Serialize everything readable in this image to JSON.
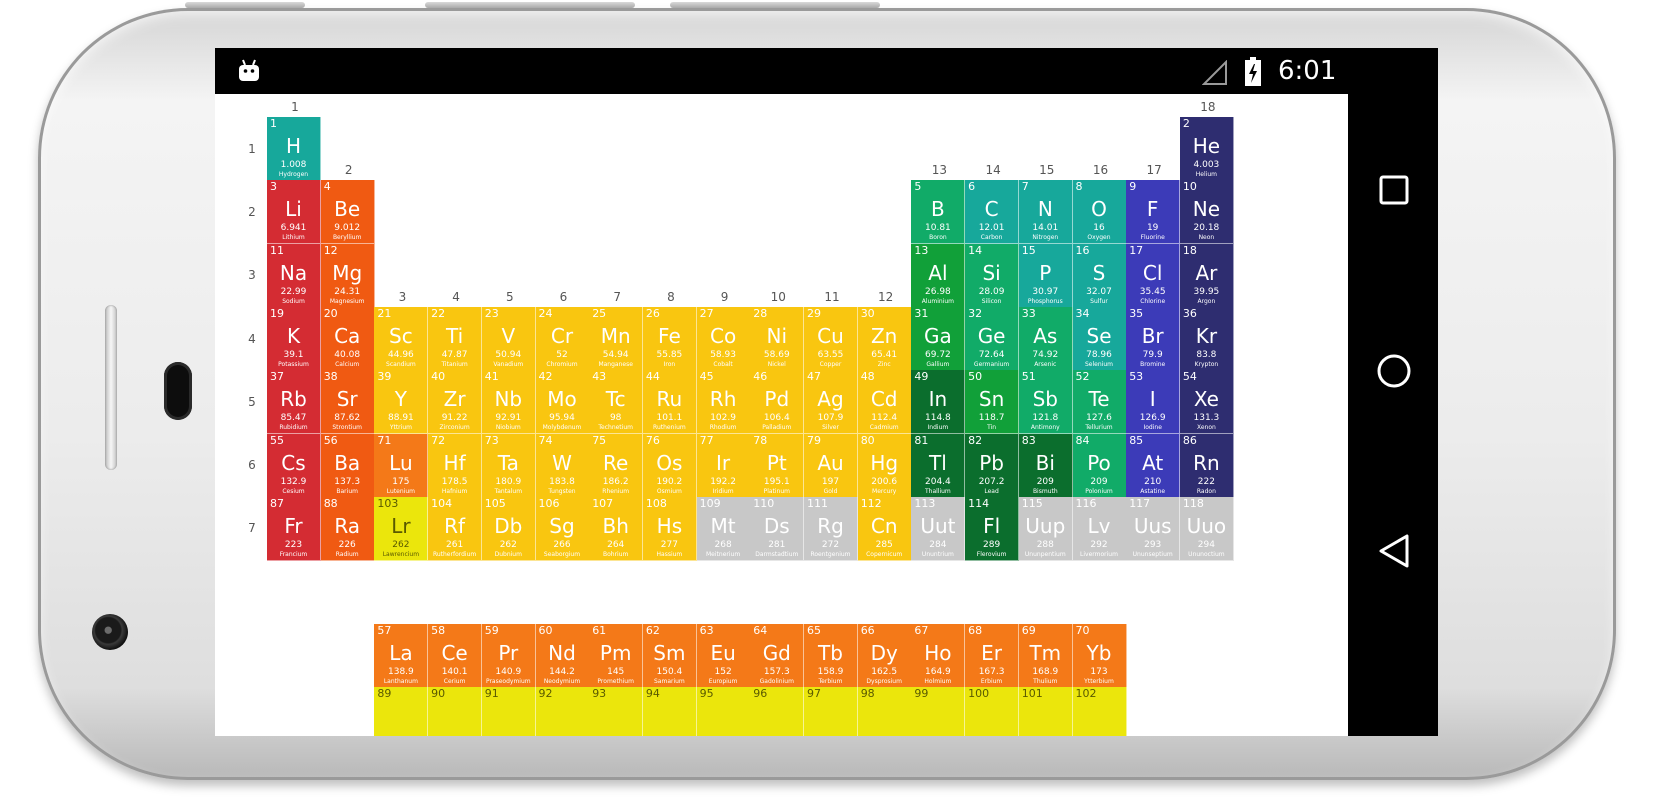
{
  "status_bar": {
    "time": "6:01",
    "left_icon": "android-notification-icon",
    "signal_icon": "signal-empty-icon",
    "battery_icon": "battery-charging-icon"
  },
  "navigation": {
    "recents": "recents-square-icon",
    "home": "home-circle-icon",
    "back": "back-triangle-icon"
  },
  "category_colors": {
    "alkali": "#d42c33",
    "alkaline": "#f05a12",
    "transition": "#f9c610",
    "post": "#11a039",
    "metalloid": "#11ab68",
    "nonmetal": "#17a89b",
    "halogen": "#3c3bb8",
    "noble": "#2e2d70",
    "lanthanide": "#f47918",
    "actinide": "#ebe60c",
    "unknown": "#c8c8c8",
    "post_dark": "#0b6e2d"
  },
  "group_labels": [
    "1",
    "2",
    "3",
    "4",
    "5",
    "6",
    "7",
    "8",
    "9",
    "10",
    "11",
    "12",
    "13",
    "14",
    "15",
    "16",
    "17",
    "18"
  ],
  "period_labels": [
    "1",
    "2",
    "3",
    "4",
    "5",
    "6",
    "7"
  ],
  "elements": [
    {
      "num": "1",
      "sym": "H",
      "mass": "1.008",
      "name": "Hydrogen",
      "cat": "nonmetal",
      "g": 1,
      "p": 1
    },
    {
      "num": "2",
      "sym": "He",
      "mass": "4.003",
      "name": "Helium",
      "cat": "noble",
      "g": 18,
      "p": 1
    },
    {
      "num": "3",
      "sym": "Li",
      "mass": "6.941",
      "name": "Lithium",
      "cat": "alkali",
      "g": 1,
      "p": 2
    },
    {
      "num": "4",
      "sym": "Be",
      "mass": "9.012",
      "name": "Beryllium",
      "cat": "alkaline",
      "g": 2,
      "p": 2
    },
    {
      "num": "5",
      "sym": "B",
      "mass": "10.81",
      "name": "Boron",
      "cat": "metalloid",
      "g": 13,
      "p": 2
    },
    {
      "num": "6",
      "sym": "C",
      "mass": "12.01",
      "name": "Carbon",
      "cat": "nonmetal",
      "g": 14,
      "p": 2
    },
    {
      "num": "7",
      "sym": "N",
      "mass": "14.01",
      "name": "Nitrogen",
      "cat": "nonmetal",
      "g": 15,
      "p": 2
    },
    {
      "num": "8",
      "sym": "O",
      "mass": "16",
      "name": "Oxygen",
      "cat": "nonmetal",
      "g": 16,
      "p": 2
    },
    {
      "num": "9",
      "sym": "F",
      "mass": "19",
      "name": "Fluorine",
      "cat": "halogen",
      "g": 17,
      "p": 2
    },
    {
      "num": "10",
      "sym": "Ne",
      "mass": "20.18",
      "name": "Neon",
      "cat": "noble",
      "g": 18,
      "p": 2
    },
    {
      "num": "11",
      "sym": "Na",
      "mass": "22.99",
      "name": "Sodium",
      "cat": "alkali",
      "g": 1,
      "p": 3
    },
    {
      "num": "12",
      "sym": "Mg",
      "mass": "24.31",
      "name": "Magnesium",
      "cat": "alkaline",
      "g": 2,
      "p": 3
    },
    {
      "num": "13",
      "sym": "Al",
      "mass": "26.98",
      "name": "Aluminium",
      "cat": "post",
      "g": 13,
      "p": 3
    },
    {
      "num": "14",
      "sym": "Si",
      "mass": "28.09",
      "name": "Silicon",
      "cat": "metalloid",
      "g": 14,
      "p": 3
    },
    {
      "num": "15",
      "sym": "P",
      "mass": "30.97",
      "name": "Phosphorus",
      "cat": "nonmetal",
      "g": 15,
      "p": 3
    },
    {
      "num": "16",
      "sym": "S",
      "mass": "32.07",
      "name": "Sulfur",
      "cat": "nonmetal",
      "g": 16,
      "p": 3
    },
    {
      "num": "17",
      "sym": "Cl",
      "mass": "35.45",
      "name": "Chlorine",
      "cat": "halogen",
      "g": 17,
      "p": 3
    },
    {
      "num": "18",
      "sym": "Ar",
      "mass": "39.95",
      "name": "Argon",
      "cat": "noble",
      "g": 18,
      "p": 3
    },
    {
      "num": "19",
      "sym": "K",
      "mass": "39.1",
      "name": "Potassium",
      "cat": "alkali",
      "g": 1,
      "p": 4
    },
    {
      "num": "20",
      "sym": "Ca",
      "mass": "40.08",
      "name": "Calcium",
      "cat": "alkaline",
      "g": 2,
      "p": 4
    },
    {
      "num": "21",
      "sym": "Sc",
      "mass": "44.96",
      "name": "Scandium",
      "cat": "transition",
      "g": 3,
      "p": 4
    },
    {
      "num": "22",
      "sym": "Ti",
      "mass": "47.87",
      "name": "Titanium",
      "cat": "transition",
      "g": 4,
      "p": 4
    },
    {
      "num": "23",
      "sym": "V",
      "mass": "50.94",
      "name": "Vanadium",
      "cat": "transition",
      "g": 5,
      "p": 4
    },
    {
      "num": "24",
      "sym": "Cr",
      "mass": "52",
      "name": "Chromium",
      "cat": "transition",
      "g": 6,
      "p": 4
    },
    {
      "num": "25",
      "sym": "Mn",
      "mass": "54.94",
      "name": "Manganese",
      "cat": "transition",
      "g": 7,
      "p": 4
    },
    {
      "num": "26",
      "sym": "Fe",
      "mass": "55.85",
      "name": "Iron",
      "cat": "transition",
      "g": 8,
      "p": 4
    },
    {
      "num": "27",
      "sym": "Co",
      "mass": "58.93",
      "name": "Cobalt",
      "cat": "transition",
      "g": 9,
      "p": 4
    },
    {
      "num": "28",
      "sym": "Ni",
      "mass": "58.69",
      "name": "Nickel",
      "cat": "transition",
      "g": 10,
      "p": 4
    },
    {
      "num": "29",
      "sym": "Cu",
      "mass": "63.55",
      "name": "Copper",
      "cat": "transition",
      "g": 11,
      "p": 4
    },
    {
      "num": "30",
      "sym": "Zn",
      "mass": "65.41",
      "name": "Zinc",
      "cat": "transition",
      "g": 12,
      "p": 4
    },
    {
      "num": "31",
      "sym": "Ga",
      "mass": "69.72",
      "name": "Gallium",
      "cat": "post",
      "g": 13,
      "p": 4
    },
    {
      "num": "32",
      "sym": "Ge",
      "mass": "72.64",
      "name": "Germanium",
      "cat": "metalloid",
      "g": 14,
      "p": 4
    },
    {
      "num": "33",
      "sym": "As",
      "mass": "74.92",
      "name": "Arsenic",
      "cat": "metalloid",
      "g": 15,
      "p": 4
    },
    {
      "num": "34",
      "sym": "Se",
      "mass": "78.96",
      "name": "Selenium",
      "cat": "nonmetal",
      "g": 16,
      "p": 4
    },
    {
      "num": "35",
      "sym": "Br",
      "mass": "79.9",
      "name": "Bromine",
      "cat": "halogen",
      "g": 17,
      "p": 4
    },
    {
      "num": "36",
      "sym": "Kr",
      "mass": "83.8",
      "name": "Krypton",
      "cat": "noble",
      "g": 18,
      "p": 4
    },
    {
      "num": "37",
      "sym": "Rb",
      "mass": "85.47",
      "name": "Rubidium",
      "cat": "alkali",
      "g": 1,
      "p": 5
    },
    {
      "num": "38",
      "sym": "Sr",
      "mass": "87.62",
      "name": "Strontium",
      "cat": "alkaline",
      "g": 2,
      "p": 5
    },
    {
      "num": "39",
      "sym": "Y",
      "mass": "88.91",
      "name": "Yttrium",
      "cat": "transition",
      "g": 3,
      "p": 5
    },
    {
      "num": "40",
      "sym": "Zr",
      "mass": "91.22",
      "name": "Zirconium",
      "cat": "transition",
      "g": 4,
      "p": 5
    },
    {
      "num": "41",
      "sym": "Nb",
      "mass": "92.91",
      "name": "Niobium",
      "cat": "transition",
      "g": 5,
      "p": 5
    },
    {
      "num": "42",
      "sym": "Mo",
      "mass": "95.94",
      "name": "Molybdenum",
      "cat": "transition",
      "g": 6,
      "p": 5
    },
    {
      "num": "43",
      "sym": "Tc",
      "mass": "98",
      "name": "Technetium",
      "cat": "transition",
      "g": 7,
      "p": 5
    },
    {
      "num": "44",
      "sym": "Ru",
      "mass": "101.1",
      "name": "Ruthenium",
      "cat": "transition",
      "g": 8,
      "p": 5
    },
    {
      "num": "45",
      "sym": "Rh",
      "mass": "102.9",
      "name": "Rhodium",
      "cat": "transition",
      "g": 9,
      "p": 5
    },
    {
      "num": "46",
      "sym": "Pd",
      "mass": "106.4",
      "name": "Palladium",
      "cat": "transition",
      "g": 10,
      "p": 5
    },
    {
      "num": "47",
      "sym": "Ag",
      "mass": "107.9",
      "name": "Silver",
      "cat": "transition",
      "g": 11,
      "p": 5
    },
    {
      "num": "48",
      "sym": "Cd",
      "mass": "112.4",
      "name": "Cadmium",
      "cat": "transition",
      "g": 12,
      "p": 5
    },
    {
      "num": "49",
      "sym": "In",
      "mass": "114.8",
      "name": "Indium",
      "cat": "post_dark",
      "g": 13,
      "p": 5
    },
    {
      "num": "50",
      "sym": "Sn",
      "mass": "118.7",
      "name": "Tin",
      "cat": "post",
      "g": 14,
      "p": 5
    },
    {
      "num": "51",
      "sym": "Sb",
      "mass": "121.8",
      "name": "Antimony",
      "cat": "metalloid",
      "g": 15,
      "p": 5
    },
    {
      "num": "52",
      "sym": "Te",
      "mass": "127.6",
      "name": "Tellurium",
      "cat": "metalloid",
      "g": 16,
      "p": 5
    },
    {
      "num": "53",
      "sym": "I",
      "mass": "126.9",
      "name": "Iodine",
      "cat": "halogen",
      "g": 17,
      "p": 5
    },
    {
      "num": "54",
      "sym": "Xe",
      "mass": "131.3",
      "name": "Xenon",
      "cat": "noble",
      "g": 18,
      "p": 5
    },
    {
      "num": "55",
      "sym": "Cs",
      "mass": "132.9",
      "name": "Cesium",
      "cat": "alkali",
      "g": 1,
      "p": 6
    },
    {
      "num": "56",
      "sym": "Ba",
      "mass": "137.3",
      "name": "Barium",
      "cat": "alkaline",
      "g": 2,
      "p": 6
    },
    {
      "num": "71",
      "sym": "Lu",
      "mass": "175",
      "name": "Lutenium",
      "cat": "lanthanide",
      "g": 3,
      "p": 6
    },
    {
      "num": "72",
      "sym": "Hf",
      "mass": "178.5",
      "name": "Hafnium",
      "cat": "transition",
      "g": 4,
      "p": 6
    },
    {
      "num": "73",
      "sym": "Ta",
      "mass": "180.9",
      "name": "Tantalum",
      "cat": "transition",
      "g": 5,
      "p": 6
    },
    {
      "num": "74",
      "sym": "W",
      "mass": "183.8",
      "name": "Tungsten",
      "cat": "transition",
      "g": 6,
      "p": 6
    },
    {
      "num": "75",
      "sym": "Re",
      "mass": "186.2",
      "name": "Rhenium",
      "cat": "transition",
      "g": 7,
      "p": 6
    },
    {
      "num": "76",
      "sym": "Os",
      "mass": "190.2",
      "name": "Osmium",
      "cat": "transition",
      "g": 8,
      "p": 6
    },
    {
      "num": "77",
      "sym": "Ir",
      "mass": "192.2",
      "name": "Iridium",
      "cat": "transition",
      "g": 9,
      "p": 6
    },
    {
      "num": "78",
      "sym": "Pt",
      "mass": "195.1",
      "name": "Platinum",
      "cat": "transition",
      "g": 10,
      "p": 6
    },
    {
      "num": "79",
      "sym": "Au",
      "mass": "197",
      "name": "Gold",
      "cat": "transition",
      "g": 11,
      "p": 6
    },
    {
      "num": "80",
      "sym": "Hg",
      "mass": "200.6",
      "name": "Mercury",
      "cat": "transition",
      "g": 12,
      "p": 6
    },
    {
      "num": "81",
      "sym": "Tl",
      "mass": "204.4",
      "name": "Thallium",
      "cat": "post_dark",
      "g": 13,
      "p": 6
    },
    {
      "num": "82",
      "sym": "Pb",
      "mass": "207.2",
      "name": "Lead",
      "cat": "post_dark",
      "g": 14,
      "p": 6
    },
    {
      "num": "83",
      "sym": "Bi",
      "mass": "209",
      "name": "Bismuth",
      "cat": "post_dark",
      "g": 15,
      "p": 6
    },
    {
      "num": "84",
      "sym": "Po",
      "mass": "209",
      "name": "Polonium",
      "cat": "metalloid",
      "g": 16,
      "p": 6
    },
    {
      "num": "85",
      "sym": "At",
      "mass": "210",
      "name": "Astatine",
      "cat": "halogen",
      "g": 17,
      "p": 6
    },
    {
      "num": "86",
      "sym": "Rn",
      "mass": "222",
      "name": "Radon",
      "cat": "noble",
      "g": 18,
      "p": 6
    },
    {
      "num": "87",
      "sym": "Fr",
      "mass": "223",
      "name": "Francium",
      "cat": "alkali",
      "g": 1,
      "p": 7
    },
    {
      "num": "88",
      "sym": "Ra",
      "mass": "226",
      "name": "Radium",
      "cat": "alkaline",
      "g": 2,
      "p": 7
    },
    {
      "num": "103",
      "sym": "Lr",
      "mass": "262",
      "name": "Lawrencium",
      "cat": "actinide",
      "g": 3,
      "p": 7
    },
    {
      "num": "104",
      "sym": "Rf",
      "mass": "261",
      "name": "Rutherfordium",
      "cat": "transition",
      "g": 4,
      "p": 7
    },
    {
      "num": "105",
      "sym": "Db",
      "mass": "262",
      "name": "Dubnium",
      "cat": "transition",
      "g": 5,
      "p": 7
    },
    {
      "num": "106",
      "sym": "Sg",
      "mass": "266",
      "name": "Seaborgium",
      "cat": "transition",
      "g": 6,
      "p": 7
    },
    {
      "num": "107",
      "sym": "Bh",
      "mass": "264",
      "name": "Bohrium",
      "cat": "transition",
      "g": 7,
      "p": 7
    },
    {
      "num": "108",
      "sym": "Hs",
      "mass": "277",
      "name": "Hassium",
      "cat": "transition",
      "g": 8,
      "p": 7
    },
    {
      "num": "109",
      "sym": "Mt",
      "mass": "268",
      "name": "Meitnerium",
      "cat": "unknown",
      "g": 9,
      "p": 7
    },
    {
      "num": "110",
      "sym": "Ds",
      "mass": "281",
      "name": "Darmstadtium",
      "cat": "unknown",
      "g": 10,
      "p": 7
    },
    {
      "num": "111",
      "sym": "Rg",
      "mass": "272",
      "name": "Roentgenium",
      "cat": "unknown",
      "g": 11,
      "p": 7
    },
    {
      "num": "112",
      "sym": "Cn",
      "mass": "285",
      "name": "Copernicum",
      "cat": "transition",
      "g": 12,
      "p": 7
    },
    {
      "num": "113",
      "sym": "Uut",
      "mass": "284",
      "name": "Ununtrium",
      "cat": "unknown",
      "g": 13,
      "p": 7
    },
    {
      "num": "114",
      "sym": "Fl",
      "mass": "289",
      "name": "Flerovium",
      "cat": "post_dark",
      "g": 14,
      "p": 7
    },
    {
      "num": "115",
      "sym": "Uup",
      "mass": "288",
      "name": "Ununpentium",
      "cat": "unknown",
      "g": 15,
      "p": 7
    },
    {
      "num": "116",
      "sym": "Lv",
      "mass": "292",
      "name": "Livermorium",
      "cat": "unknown",
      "g": 16,
      "p": 7
    },
    {
      "num": "117",
      "sym": "Uus",
      "mass": "293",
      "name": "Ununseptium",
      "cat": "unknown",
      "g": 17,
      "p": 7
    },
    {
      "num": "118",
      "sym": "Uuo",
      "mass": "294",
      "name": "Ununoctium",
      "cat": "unknown",
      "g": 18,
      "p": 7
    },
    {
      "num": "57",
      "sym": "La",
      "mass": "138.9",
      "name": "Lanthanum",
      "cat": "lanthanide",
      "g": 3,
      "p": 9
    },
    {
      "num": "58",
      "sym": "Ce",
      "mass": "140.1",
      "name": "Cerium",
      "cat": "lanthanide",
      "g": 4,
      "p": 9
    },
    {
      "num": "59",
      "sym": "Pr",
      "mass": "140.9",
      "name": "Praseodymium",
      "cat": "lanthanide",
      "g": 5,
      "p": 9
    },
    {
      "num": "60",
      "sym": "Nd",
      "mass": "144.2",
      "name": "Neodymium",
      "cat": "lanthanide",
      "g": 6,
      "p": 9
    },
    {
      "num": "61",
      "sym": "Pm",
      "mass": "145",
      "name": "Promethium",
      "cat": "lanthanide",
      "g": 7,
      "p": 9
    },
    {
      "num": "62",
      "sym": "Sm",
      "mass": "150.4",
      "name": "Samarium",
      "cat": "lanthanide",
      "g": 8,
      "p": 9
    },
    {
      "num": "63",
      "sym": "Eu",
      "mass": "152",
      "name": "Europium",
      "cat": "lanthanide",
      "g": 9,
      "p": 9
    },
    {
      "num": "64",
      "sym": "Gd",
      "mass": "157.3",
      "name": "Gadolinium",
      "cat": "lanthanide",
      "g": 10,
      "p": 9
    },
    {
      "num": "65",
      "sym": "Tb",
      "mass": "158.9",
      "name": "Terbium",
      "cat": "lanthanide",
      "g": 11,
      "p": 9
    },
    {
      "num": "66",
      "sym": "Dy",
      "mass": "162.5",
      "name": "Dysprosium",
      "cat": "lanthanide",
      "g": 12,
      "p": 9
    },
    {
      "num": "67",
      "sym": "Ho",
      "mass": "164.9",
      "name": "Holmium",
      "cat": "lanthanide",
      "g": 13,
      "p": 9
    },
    {
      "num": "68",
      "sym": "Er",
      "mass": "167.3",
      "name": "Erbium",
      "cat": "lanthanide",
      "g": 14,
      "p": 9
    },
    {
      "num": "69",
      "sym": "Tm",
      "mass": "168.9",
      "name": "Thulium",
      "cat": "lanthanide",
      "g": 15,
      "p": 9
    },
    {
      "num": "70",
      "sym": "Yb",
      "mass": "173",
      "name": "Ytterbium",
      "cat": "lanthanide",
      "g": 16,
      "p": 9
    },
    {
      "num": "89",
      "sym": "",
      "mass": "",
      "name": "",
      "cat": "actinide",
      "g": 3,
      "p": 10
    },
    {
      "num": "90",
      "sym": "",
      "mass": "",
      "name": "",
      "cat": "actinide",
      "g": 4,
      "p": 10
    },
    {
      "num": "91",
      "sym": "",
      "mass": "",
      "name": "",
      "cat": "actinide",
      "g": 5,
      "p": 10
    },
    {
      "num": "92",
      "sym": "",
      "mass": "",
      "name": "",
      "cat": "actinide",
      "g": 6,
      "p": 10
    },
    {
      "num": "93",
      "sym": "",
      "mass": "",
      "name": "",
      "cat": "actinide",
      "g": 7,
      "p": 10
    },
    {
      "num": "94",
      "sym": "",
      "mass": "",
      "name": "",
      "cat": "actinide",
      "g": 8,
      "p": 10
    },
    {
      "num": "95",
      "sym": "",
      "mass": "",
      "name": "",
      "cat": "actinide",
      "g": 9,
      "p": 10
    },
    {
      "num": "96",
      "sym": "",
      "mass": "",
      "name": "",
      "cat": "actinide",
      "g": 10,
      "p": 10
    },
    {
      "num": "97",
      "sym": "",
      "mass": "",
      "name": "",
      "cat": "actinide",
      "g": 11,
      "p": 10
    },
    {
      "num": "98",
      "sym": "",
      "mass": "",
      "name": "",
      "cat": "actinide",
      "g": 12,
      "p": 10
    },
    {
      "num": "99",
      "sym": "",
      "mass": "",
      "name": "",
      "cat": "actinide",
      "g": 13,
      "p": 10
    },
    {
      "num": "100",
      "sym": "",
      "mass": "",
      "name": "",
      "cat": "actinide",
      "g": 14,
      "p": 10
    },
    {
      "num": "101",
      "sym": "",
      "mass": "",
      "name": "",
      "cat": "actinide",
      "g": 15,
      "p": 10
    },
    {
      "num": "102",
      "sym": "",
      "mass": "",
      "name": "",
      "cat": "actinide",
      "g": 16,
      "p": 10
    }
  ]
}
